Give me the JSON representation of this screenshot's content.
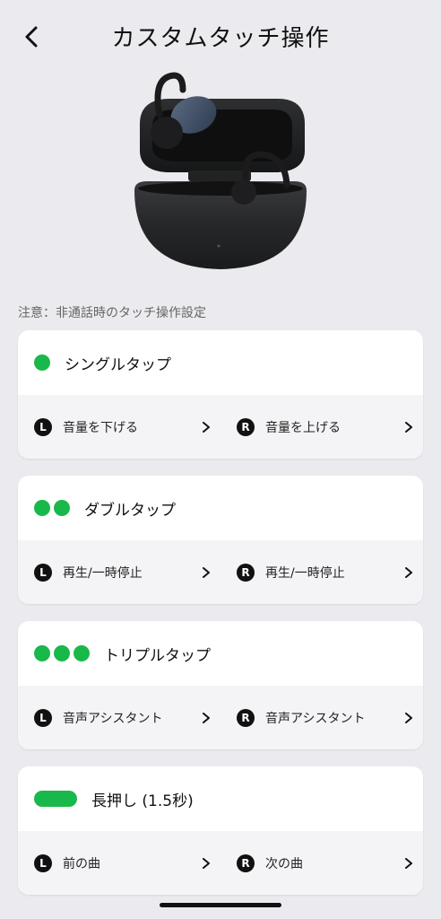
{
  "header": {
    "title": "カスタムタッチ操作"
  },
  "note": "注意：非通話時のタッチ操作設定",
  "gestures": [
    {
      "label": "シングルタップ",
      "left": {
        "badge": "L",
        "action": "音量を下げる"
      },
      "right": {
        "badge": "R",
        "action": "音量を上げる"
      }
    },
    {
      "label": "ダブルタップ",
      "left": {
        "badge": "L",
        "action": "再生/一時停止"
      },
      "right": {
        "badge": "R",
        "action": "再生/一時停止"
      }
    },
    {
      "label": "トリプルタップ",
      "left": {
        "badge": "L",
        "action": "音声アシスタント"
      },
      "right": {
        "badge": "R",
        "action": "音声アシスタント"
      }
    },
    {
      "label": "長押し (1.5秒)",
      "left": {
        "badge": "L",
        "action": "前の曲"
      },
      "right": {
        "badge": "R",
        "action": "次の曲"
      }
    }
  ],
  "colors": {
    "accent_green": "#19b84a",
    "background": "#ebebef"
  },
  "icons": {
    "back": "chevron-left-icon",
    "row_arrow": "chevron-right-icon"
  }
}
